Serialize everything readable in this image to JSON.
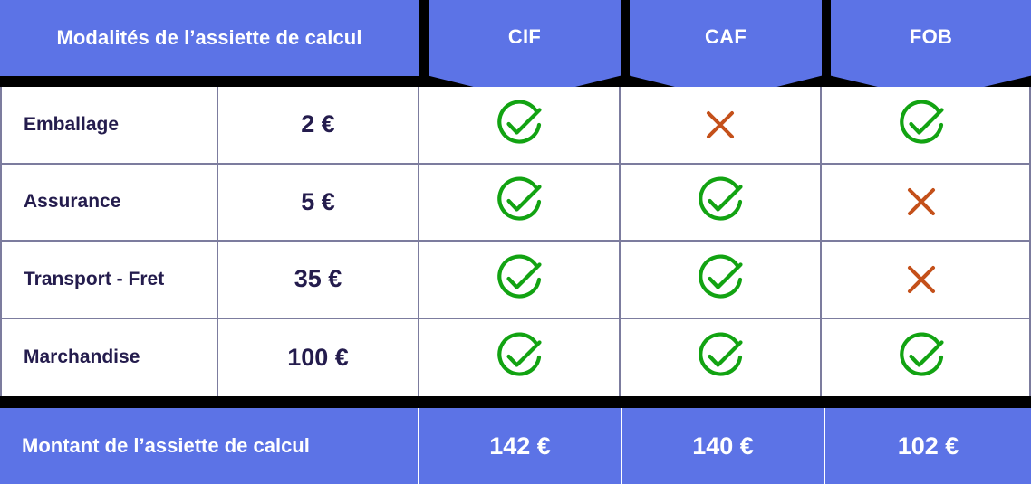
{
  "header": {
    "title": "Modalités de l’assiette de calcul",
    "columns": [
      {
        "label": "CIF"
      },
      {
        "label": "CAF"
      },
      {
        "label": "FOB"
      }
    ]
  },
  "rows": [
    {
      "label": "Emballage",
      "amount": "2 €",
      "marks": [
        "check",
        "cross",
        "check"
      ]
    },
    {
      "label": "Assurance",
      "amount": "5 €",
      "marks": [
        "check",
        "check",
        "cross"
      ]
    },
    {
      "label": "Transport - Fret",
      "amount": "35 €",
      "marks": [
        "check",
        "check",
        "cross"
      ]
    },
    {
      "label": "Marchandise",
      "amount": "100 €",
      "marks": [
        "check",
        "check",
        "check"
      ]
    }
  ],
  "footer": {
    "title": "Montant de l’assiette de calcul",
    "values": [
      "142 €",
      "140 €",
      "102 €"
    ]
  },
  "icons": {
    "check": "circle-check-icon",
    "cross": "cross-icon"
  },
  "colors": {
    "brand_blue": "#5C73E6",
    "navy_text": "#241C4D",
    "check_green": "#12A312",
    "cross_orange": "#C4501A",
    "grid_line": "#7C7C9E",
    "black_band": "#000000",
    "white": "#FFFFFF"
  }
}
